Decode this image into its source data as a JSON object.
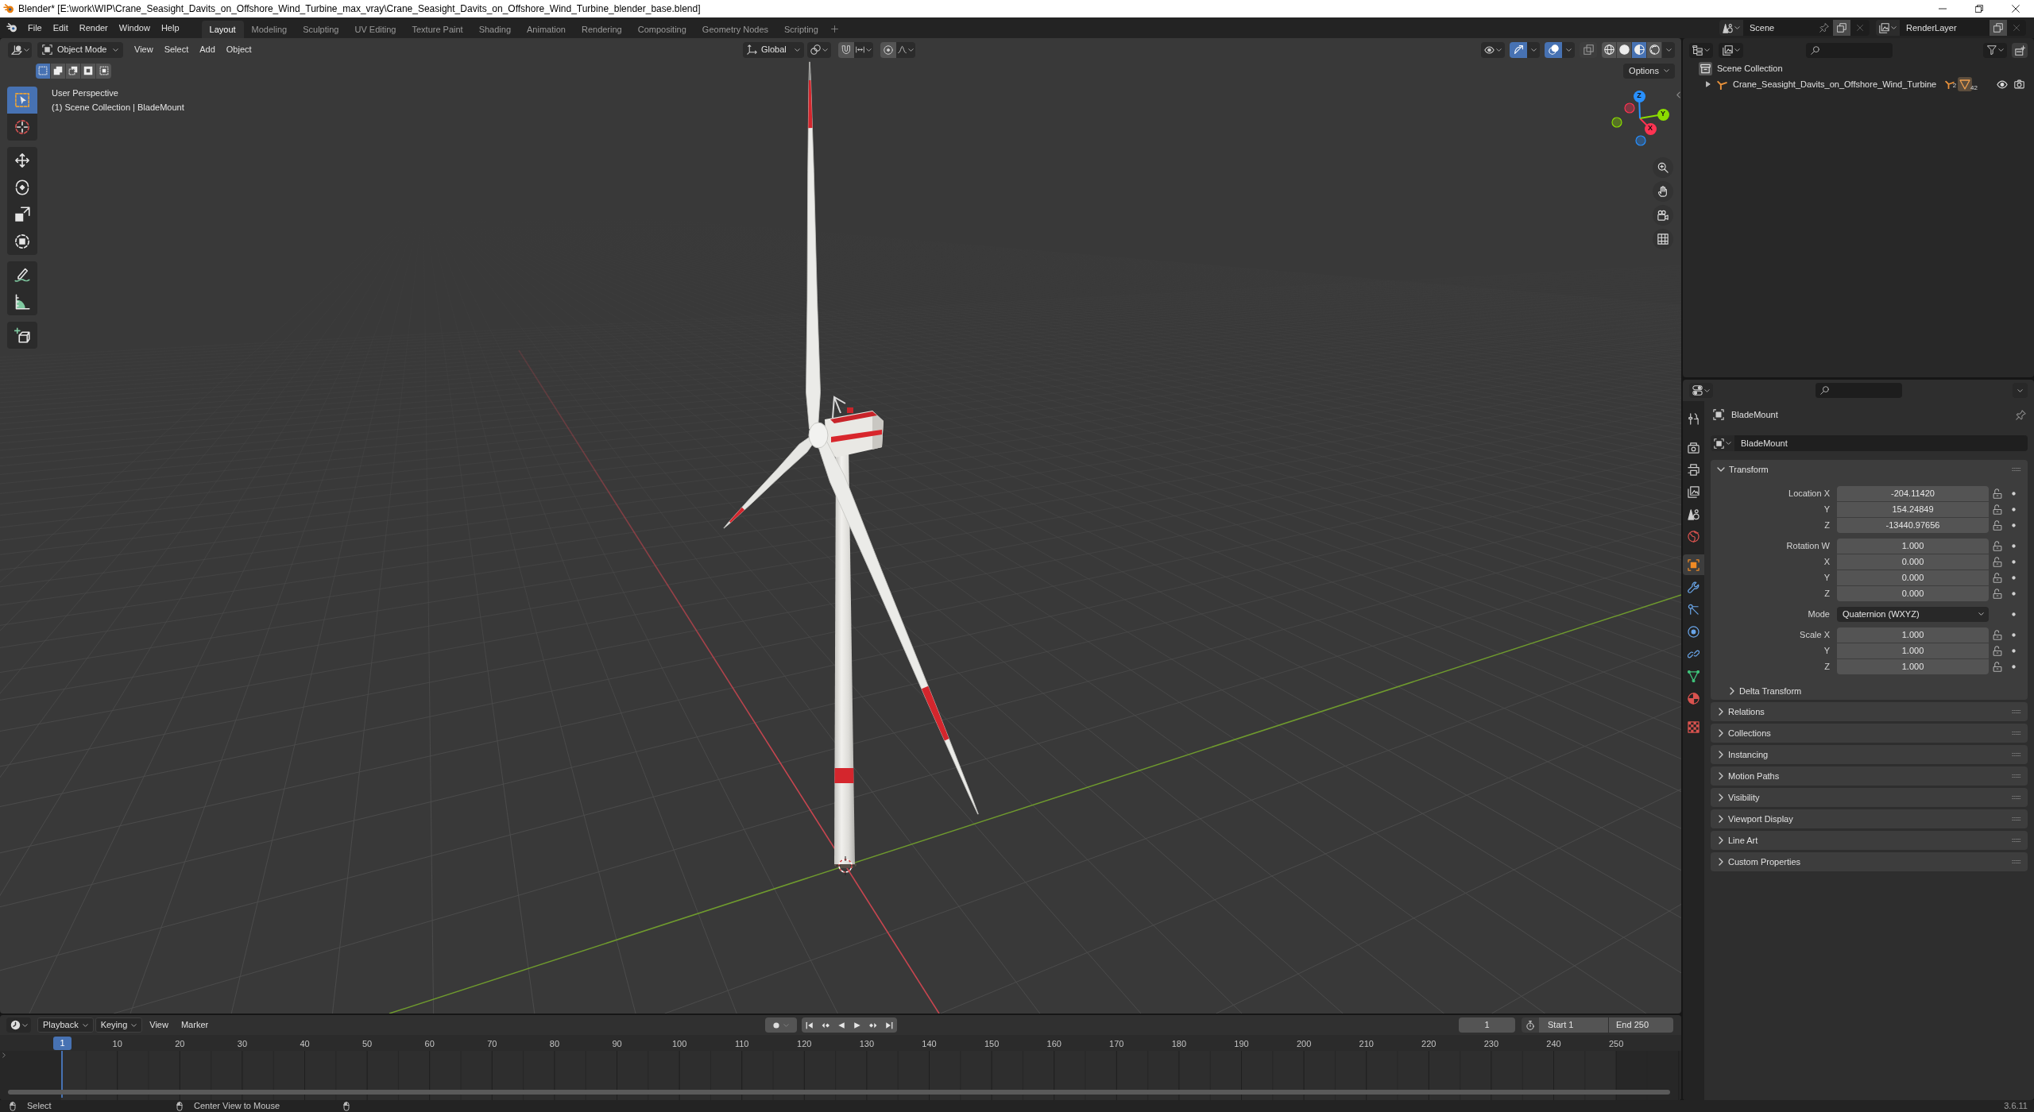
{
  "window": {
    "title": "Blender* [E:\\work\\WIP\\Crane_Seasight_Davits_on_Offshore_Wind_Turbine_max_vray\\Crane_Seasight_Davits_on_Offshore_Wind_Turbine_blender_base.blend]"
  },
  "menu": [
    "File",
    "Edit",
    "Render",
    "Window",
    "Help"
  ],
  "workspaces": [
    {
      "label": "Layout",
      "selected": true
    },
    {
      "label": "Modeling",
      "selected": false
    },
    {
      "label": "Sculpting",
      "selected": false
    },
    {
      "label": "UV Editing",
      "selected": false
    },
    {
      "label": "Texture Paint",
      "selected": false
    },
    {
      "label": "Shading",
      "selected": false
    },
    {
      "label": "Animation",
      "selected": false
    },
    {
      "label": "Rendering",
      "selected": false
    },
    {
      "label": "Compositing",
      "selected": false
    },
    {
      "label": "Geometry Nodes",
      "selected": false
    },
    {
      "label": "Scripting",
      "selected": false
    }
  ],
  "scene": {
    "name": "Scene"
  },
  "view_layer": {
    "name": "RenderLayer"
  },
  "viewport": {
    "mode": "Object Mode",
    "menus": [
      "View",
      "Select",
      "Add",
      "Object"
    ],
    "orientation": "Global",
    "toggles": [
      {
        "kind": "gizmos",
        "on": true
      },
      {
        "kind": "overlays",
        "on": true
      },
      {
        "kind": "xray",
        "on": false
      }
    ],
    "shading": [
      {
        "kind": "wireframe",
        "selected": false
      },
      {
        "kind": "solid",
        "selected": false
      },
      {
        "kind": "material",
        "selected": true
      },
      {
        "kind": "rendered",
        "selected": false
      }
    ],
    "selection_modes": [
      {
        "kind": "set",
        "selected": true
      },
      {
        "kind": "extend",
        "selected": false
      },
      {
        "kind": "subtract",
        "selected": false
      },
      {
        "kind": "invert",
        "selected": false
      },
      {
        "kind": "intersect",
        "selected": false
      }
    ],
    "options": "Options",
    "info": [
      "User Perspective",
      "(1) Scene Collection | BladeMount"
    ],
    "tools": [
      {
        "kind": "select_box",
        "selected": true
      },
      {
        "kind": "cursor",
        "selected": false
      },
      {
        "kind": "move",
        "selected": false
      },
      {
        "kind": "rotate",
        "selected": false
      },
      {
        "kind": "scale",
        "selected": false
      },
      {
        "kind": "transform",
        "selected": false
      },
      {
        "kind": "annotate",
        "selected": false
      },
      {
        "kind": "measure",
        "selected": false
      },
      {
        "kind": "add_cube",
        "selected": false
      }
    ],
    "axes": [
      {
        "label": "X",
        "color": "#ff3352"
      },
      {
        "label": "Y",
        "color": "#8bdc00"
      },
      {
        "label": "Z",
        "color": "#2890ff"
      }
    ]
  },
  "outliner": {
    "tree": [
      {
        "label": "Scene Collection",
        "children": [
          {
            "label": "Crane_Seasight_Davits_on_Offshore_Wind_Turbine",
            "expanded": false,
            "child_types": [
              {
                "kind": "armature",
                "count": "2"
              },
              {
                "kind": "mesh",
                "count": "42"
              }
            ]
          }
        ]
      }
    ]
  },
  "properties": {
    "tabs": [
      {
        "kind": "tool",
        "selected": false
      },
      {
        "kind": "render",
        "selected": false
      },
      {
        "kind": "output",
        "selected": false
      },
      {
        "kind": "view_layer",
        "selected": false
      },
      {
        "kind": "scene",
        "selected": false
      },
      {
        "kind": "world",
        "selected": false
      },
      {
        "kind": "object",
        "selected": true
      },
      {
        "kind": "modifiers",
        "selected": false
      },
      {
        "kind": "particles",
        "selected": false
      },
      {
        "kind": "physics",
        "selected": false
      },
      {
        "kind": "constraints",
        "selected": false
      },
      {
        "kind": "data",
        "selected": false
      },
      {
        "kind": "material",
        "selected": false
      },
      {
        "kind": "texture",
        "selected": false
      }
    ],
    "object": "BladeMount",
    "datablock": "BladeMount",
    "panels": [
      {
        "title": "Transform",
        "expanded": true,
        "groups": [
          {
            "fields": [
              {
                "kind": "number",
                "label": "Location X",
                "value": "-204.11420"
              },
              {
                "kind": "number",
                "label": "Y",
                "value": "154.24849"
              },
              {
                "kind": "number",
                "label": "Z",
                "value": "-13440.97656"
              }
            ]
          },
          {
            "fields": [
              {
                "kind": "number",
                "label": "Rotation W",
                "value": "1.000"
              },
              {
                "kind": "number",
                "label": "X",
                "value": "0.000"
              },
              {
                "kind": "number",
                "label": "Y",
                "value": "0.000"
              },
              {
                "kind": "number",
                "label": "Z",
                "value": "0.000"
              }
            ]
          },
          {
            "fields": [
              {
                "kind": "dropdown",
                "label": "Mode",
                "value": "Quaternion (WXYZ)"
              }
            ]
          },
          {
            "fields": [
              {
                "kind": "number",
                "label": "Scale X",
                "value": "1.000"
              },
              {
                "kind": "number",
                "label": "Y",
                "value": "1.000"
              },
              {
                "kind": "number",
                "label": "Z",
                "value": "1.000"
              }
            ]
          }
        ],
        "subpanels": [
          {
            "title": "Delta Transform",
            "expanded": false
          }
        ]
      },
      {
        "title": "Relations",
        "expanded": false
      },
      {
        "title": "Collections",
        "expanded": false
      },
      {
        "title": "Instancing",
        "expanded": false
      },
      {
        "title": "Motion Paths",
        "expanded": false
      },
      {
        "title": "Visibility",
        "expanded": false
      },
      {
        "title": "Viewport Display",
        "expanded": false
      },
      {
        "title": "Line Art",
        "expanded": false
      },
      {
        "title": "Custom Properties",
        "expanded": false
      }
    ]
  },
  "timeline": {
    "menus": [
      {
        "label": "Playback",
        "kind": "dropdown"
      },
      {
        "label": "Keying",
        "kind": "dropdown"
      },
      {
        "label": "View",
        "kind": "menu"
      },
      {
        "label": "Marker",
        "kind": "menu"
      }
    ],
    "current_frame": "1",
    "start": {
      "label": "Start",
      "value": "1"
    },
    "end": {
      "label": "End",
      "value": "250"
    },
    "playhead": "1",
    "ruler": [
      "10",
      "20",
      "30",
      "40",
      "50",
      "60",
      "70",
      "80",
      "90",
      "100",
      "110",
      "120",
      "130",
      "140",
      "150",
      "160",
      "170",
      "180",
      "190",
      "200",
      "210",
      "220",
      "230",
      "240",
      "250"
    ]
  },
  "status_bar": {
    "hints": [
      "Select",
      "Center View to Mouse"
    ],
    "version": "3.6.11"
  }
}
